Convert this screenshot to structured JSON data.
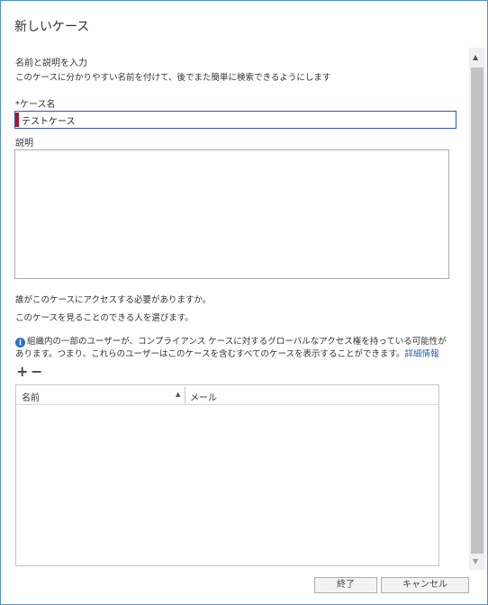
{
  "window": {
    "title": "新しいケース"
  },
  "section": {
    "heading": "名前と説明を入力",
    "description": "このケースに分かりやすい名前を付けて、後でまた簡単に検索できるようにします"
  },
  "case_name": {
    "label": "*ケース名",
    "value": "テストケース"
  },
  "description_field": {
    "label": "説明",
    "value": ""
  },
  "access": {
    "question": "誰がこのケースにアクセスする必要がありますか。",
    "instruction": "このケースを見ることのできる人を選びます。",
    "info_text": "組織内の一部のユーザーが、コンプライアンス ケースに対するグローバルなアクセス権を持っている可能性があります。つまり、これらのユーザーはこのケースを含むすべてのケースを表示することができます。",
    "info_link": "詳細情報"
  },
  "members_table": {
    "columns": [
      "名前",
      "メール"
    ],
    "rows": []
  },
  "icons": {
    "add": "+",
    "remove": "−",
    "info": "i",
    "sort": "▲",
    "scroll_up": "▲",
    "scroll_down": "▼"
  },
  "buttons": {
    "finish": "終了",
    "cancel": "キャンセル"
  },
  "colors": {
    "accent": "#3b52b5",
    "marker": "#9b1b2e",
    "link": "#2560b8",
    "info": "#2b72c2"
  }
}
